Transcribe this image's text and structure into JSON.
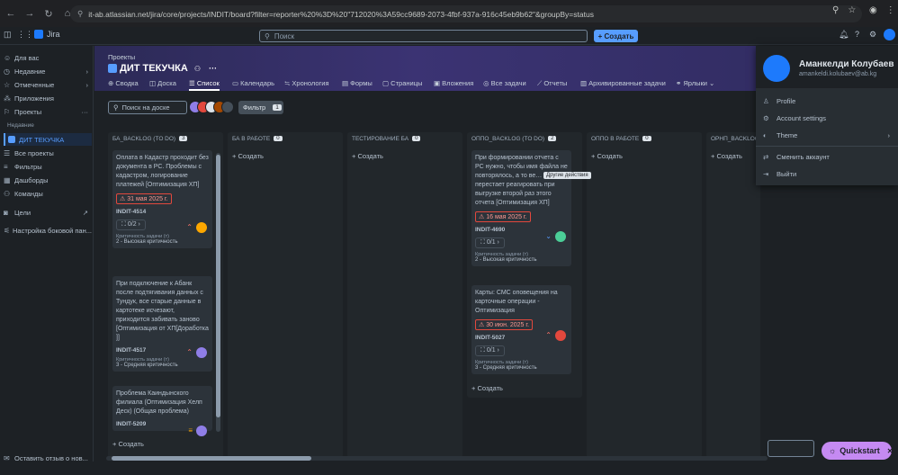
{
  "browser": {
    "url": "it-ab.atlassian.net/jira/core/projects/INDIT/board?filter=reporter%20%3D%20\"712020%3A59cc9689-2073-4fbf-937a-916c45eb9b62\"&groupBy=status"
  },
  "topnav": {
    "app_name": "Jira",
    "search_placeholder": "Поиск",
    "create_label": "+ Создать"
  },
  "sidebar": {
    "items": [
      {
        "label": "Для вас",
        "icon": "user-icon"
      },
      {
        "label": "Недавние",
        "icon": "clock-icon"
      },
      {
        "label": "Отмеченные",
        "icon": "star-icon"
      },
      {
        "label": "Приложения",
        "icon": "apps-icon"
      },
      {
        "label": "Проекты",
        "icon": "projects-icon"
      }
    ],
    "section_recent": "Недавние",
    "active_project": "ДИТ ТЕКУЧКА",
    "all_projects": "Все проекты",
    "items2": [
      {
        "label": "Фильтры",
        "icon": "filter-icon"
      },
      {
        "label": "Дашборды",
        "icon": "dashboard-icon"
      },
      {
        "label": "Команды",
        "icon": "teams-icon"
      },
      {
        "label": "Цели",
        "icon": "goals-icon"
      },
      {
        "label": "Настройка боковой пан...",
        "icon": "settings-icon"
      }
    ],
    "feedback": "Оставить отзыв о нов..."
  },
  "project": {
    "breadcrumb": "Проекты",
    "title": "ДИТ ТЕКУЧКА",
    "tabs": [
      {
        "label": "Сводка",
        "icon": "globe-icon"
      },
      {
        "label": "Доска",
        "icon": "board-icon"
      },
      {
        "label": "Список",
        "icon": "list-icon",
        "active": true
      },
      {
        "label": "Календарь",
        "icon": "calendar-icon"
      },
      {
        "label": "Хронология",
        "icon": "timeline-icon"
      },
      {
        "label": "Формы",
        "icon": "forms-icon"
      },
      {
        "label": "Страницы",
        "icon": "pages-icon"
      },
      {
        "label": "Вложения",
        "icon": "attachments-icon"
      },
      {
        "label": "Все задачи",
        "icon": "tasks-icon"
      },
      {
        "label": "Отчеты",
        "icon": "reports-icon"
      },
      {
        "label": "Архивированные задачи",
        "icon": "archive-icon"
      },
      {
        "label": "Ярлыки",
        "icon": "shortcuts-icon"
      }
    ]
  },
  "board": {
    "search_placeholder": "Поиск на доске",
    "filter_label": "Фильтр",
    "filter_count": "1",
    "create_label": "+ Создать",
    "crit_label": "Критичность задачи (т)",
    "columns": [
      {
        "title": "БА_BACKLOG (TO DO)",
        "count": "3"
      },
      {
        "title": "БА В РАБОТЕ",
        "count": "0"
      },
      {
        "title": "ТЕСТИРОВАНИЕ БА",
        "count": "0"
      },
      {
        "title": "ОППО_BACKLOG (TO DO)",
        "count": "2"
      },
      {
        "title": "ОППО В РАБОТЕ",
        "count": "0"
      },
      {
        "title": "ОРНП_BACKLOG",
        "count": ""
      }
    ],
    "cards": [
      {
        "title": "Оплата в Кадастр проходит без документа в РС. Проблемы с кадастром, логирование платежей [Оптимизация ХП]",
        "due": "31 мая 2025 г.",
        "key": "INDIT-4514",
        "sub": "0/2",
        "crit": "2 - Высокая критичность"
      },
      {
        "title": "При подключение к Абанк после подтягивания данных с Тундук, все старые данные в картотеке исчезают, приходится забивать заново [Оптимизация от ХП[Доработка ]]",
        "key": "INDIT-4517",
        "crit": "3 - Средняя критичность"
      },
      {
        "title": "Проблема Каиндынского филиала (Оптимизация Хелп Деск) (Общая проблема)",
        "key": "INDIT-5209"
      },
      {
        "title": "При формировании отчета с РС нужно, чтобы имя файла не повторялось, а то ве… Excel перестает реагировать при выгрузке второй раз этого отчета [Оптимизация ХП]",
        "due": "16 мая 2025 г.",
        "key": "INDIT-4690",
        "sub": "0/1",
        "crit": "2 - Высокая критичность"
      },
      {
        "title": "Карты: СМС оповещения на карточные операции - Оптимизация",
        "due": "30 июн. 2025 г.",
        "key": "INDIT-5027",
        "sub": "0/1",
        "crit": "3 - Средняя критичность"
      }
    ]
  },
  "tooltip": "Другие действия",
  "profile": {
    "name": "Аманкелди Колубаев",
    "email": "amankeldi.kolubaev@ab.kg",
    "items": [
      {
        "label": "Profile",
        "icon": "person-icon"
      },
      {
        "label": "Account settings",
        "icon": "gear-icon"
      },
      {
        "label": "Theme",
        "icon": "theme-icon"
      },
      {
        "label": "Сменить аккаунт",
        "icon": "switch-account-icon"
      },
      {
        "label": "Выйти",
        "icon": "logout-icon"
      }
    ]
  },
  "quickstart": "Quickstart"
}
